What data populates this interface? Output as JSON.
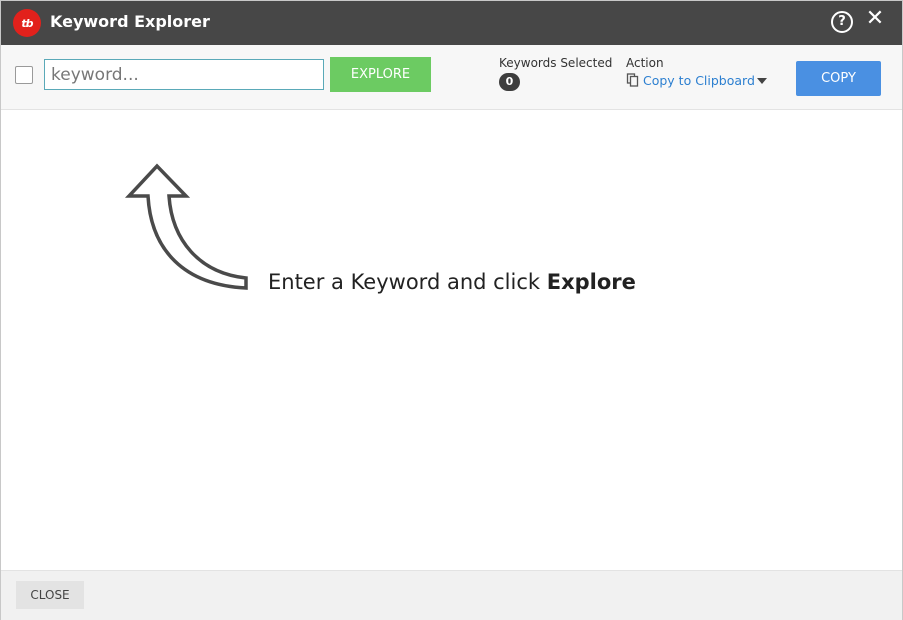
{
  "window": {
    "title": "Keyword Explorer",
    "logo_text": "tb",
    "help_icon": "?",
    "close_icon": "✕"
  },
  "toolbar": {
    "keyword_input": {
      "value": "",
      "placeholder": "keyword..."
    },
    "explore_label": "EXPLORE",
    "keywords_selected_label": "Keywords Selected",
    "keywords_selected_count": "0",
    "action_label": "Action",
    "action_value": "Copy to Clipboard",
    "copy_label": "COPY"
  },
  "main": {
    "hint_prefix": "Enter a Keyword and click ",
    "hint_emphasis": "Explore"
  },
  "footer": {
    "close_label": "CLOSE"
  },
  "colors": {
    "titlebar": "#474747",
    "logo": "#e2211c",
    "explore_button": "#6ccb62",
    "copy_button": "#4a90e2",
    "link": "#2c7fd0"
  },
  "icons": {
    "logo": "tubebuddy-logo-icon",
    "help": "help-circle-icon",
    "close": "close-icon",
    "copy": "copy-icon",
    "dropdown": "caret-down-icon",
    "hint": "curved-arrow-up-icon"
  }
}
